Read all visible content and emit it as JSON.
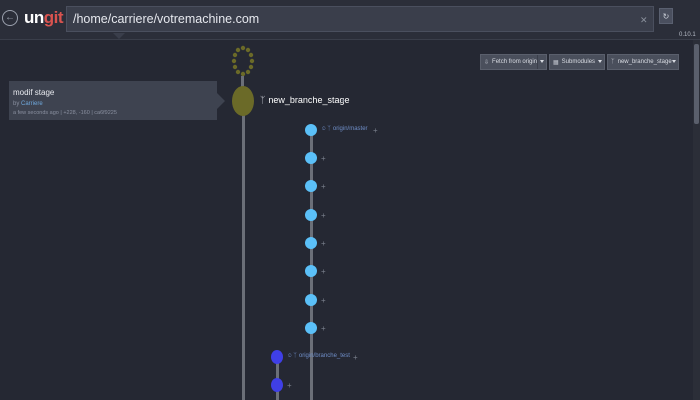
{
  "app": {
    "logo_un": "un",
    "logo_git": "git",
    "version": "0.10.1"
  },
  "path": {
    "value": "/home/carriere/votremachine.com",
    "clear_icon": "close-icon",
    "refresh_icon": "refresh-icon"
  },
  "toolbar": {
    "fetch_label": "Fetch from origin",
    "submodules_label": "Submodules",
    "branch_label": "new_branche_stage"
  },
  "commit": {
    "title": "modif stage",
    "by": "by",
    "author": "Carriere",
    "meta": "a few seconds ago | +228, -160 | ca6f9225"
  },
  "graph": {
    "head_branch": "new_branche_stage",
    "origin_master": "origin/master",
    "origin_branche_test": "origin/branche_test",
    "plus": "+"
  },
  "colors": {
    "background": "#252833",
    "head_node": "#6b6a28",
    "master_node": "#5bc0f8",
    "test_node": "#3f3fe6",
    "accent_red": "#d9534f"
  }
}
